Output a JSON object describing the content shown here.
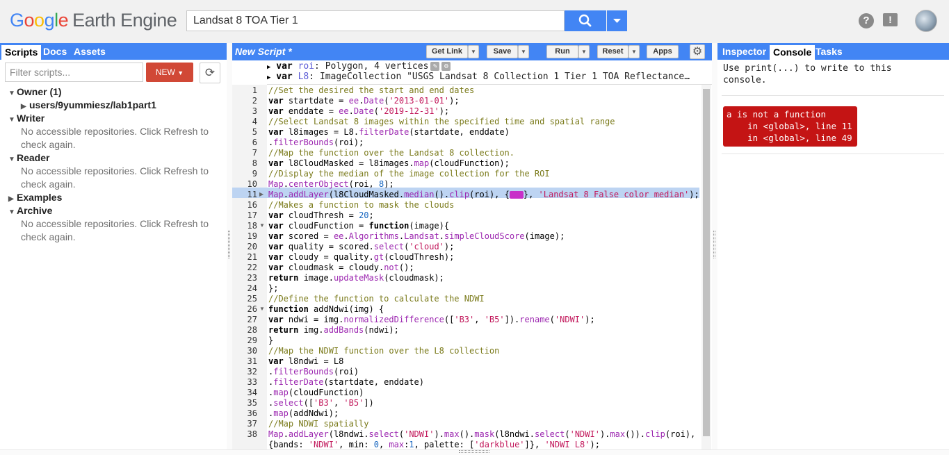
{
  "header": {
    "logo_google": [
      "G",
      "o",
      "o",
      "g",
      "l",
      "e"
    ],
    "logo_rest": "Earth Engine",
    "search_value": "Landsat 8 TOA Tier 1"
  },
  "left_panel": {
    "tabs": [
      "Scripts",
      "Docs",
      "Assets"
    ],
    "filter_placeholder": "Filter scripts...",
    "new_label": "NEW",
    "tree": {
      "owner": "Owner",
      "owner_count": "(1)",
      "owner_repo": "users/9yummiesz/lab1part1",
      "writer": "Writer",
      "writer_note": "No accessible repositories. Click Refresh to check again.",
      "reader": "Reader",
      "reader_note": "No accessible repositories. Click Refresh to check again.",
      "examples": "Examples",
      "archive": "Archive",
      "archive_note": "No accessible repositories. Click Refresh to check again."
    }
  },
  "editor": {
    "title": "New Script *",
    "buttons": {
      "get_link": "Get Link",
      "save": "Save",
      "run": "Run",
      "reset": "Reset",
      "apps": "Apps"
    },
    "imports": [
      {
        "kw": "var",
        "name": "roi",
        "text": ": Polygon, 4 vertices"
      },
      {
        "kw": "var",
        "name": "L8",
        "text": ": ImageCollection \"USGS Landsat 8 Collection 1 Tier 1 TOA Reflectance…"
      }
    ],
    "line_numbers": [
      "1",
      "2",
      "3",
      "4",
      "5",
      "6",
      "7",
      "8",
      "9",
      "10",
      "11",
      "16",
      "17",
      "18",
      "19",
      "20",
      "21",
      "22",
      "23",
      "24",
      "25",
      "26",
      "27",
      "28",
      "29",
      "30",
      "31",
      "32",
      "33",
      "34",
      "35",
      "36",
      "37",
      "38",
      ""
    ],
    "code_lines": [
      "//Set the desired the start and end dates",
      "var startdate = ee.Date('2013-01-01');",
      "var enddate = ee.Date('2019-12-31');",
      "//Select Landsat 8 images within the specified time and spatial range",
      "var l8images = L8.filterDate(startdate, enddate)",
      ".filterBounds(roi);",
      "//Map the function over the Landsat 8 collection.",
      "var l8CloudMasked = l8images.map(cloudFunction);",
      "//Display the median of the image collection for the ROI",
      "Map.centerObject(roi, 8);",
      "Map.addLayer(l8CloudMasked.median().clip(roi), {[badge]}, 'Landsat 8 False color median');",
      "//Makes a function to mask the clouds",
      "var cloudThresh = 20;",
      "var cloudFunction = function(image){",
      "var scored = ee.Algorithms.Landsat.simpleCloudScore(image);",
      "var quality = scored.select('cloud');",
      "var cloudy = quality.gt(cloudThresh);",
      "var cloudmask = cloudy.not();",
      "return image.updateMask(cloudmask);",
      "};",
      "//Define the function to calculate the NDWI",
      "function addNdwi(img) {",
      "var ndwi = img.normalizedDifference(['B3', 'B5']).rename('NDWI');",
      "return img.addBands(ndwi);",
      "}",
      "//Map the NDWI function over the L8 collection",
      "var l8ndwi = L8",
      ".filterBounds(roi)",
      ".filterDate(startdate, enddate)",
      ".map(cloudFunction)",
      ".select(['B3', 'B5'])",
      ".map(addNdwi);",
      "//Map NDWI spatially",
      "Map.addLayer(l8ndwi.select('NDWI').max().mask(l8ndwi.select('NDWI').max()).clip(roi),",
      "{bands: 'NDWI', min: 0, max:1, palette: ['darkblue']}, 'NDWI L8');"
    ]
  },
  "right_panel": {
    "tabs": [
      "Inspector",
      "Console",
      "Tasks"
    ],
    "console_hint": "Use print(...) to write to this console.",
    "error": "a is not a function\n    in <global>, line 11\n    in <global>, line 49"
  },
  "colors": {
    "accent": "#4285f4",
    "new_button": "#d14836",
    "error_bg": "#c41414",
    "highlight_line": "#bdd4f2"
  }
}
